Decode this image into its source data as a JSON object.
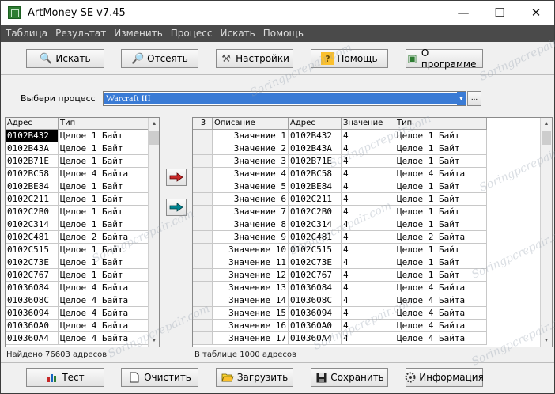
{
  "window": {
    "title": "ArtMoney SE v7.45",
    "minimize": "—",
    "maximize": "☐",
    "close": "✕"
  },
  "menu": [
    "Таблица",
    "Результат",
    "Изменить",
    "Процесс",
    "Искать",
    "Помощь"
  ],
  "toolbar": {
    "search": "Искать",
    "filter": "Отсеять",
    "settings": "Настройки",
    "help": "Помощь",
    "about": "О программе"
  },
  "process": {
    "label": "Выбери процесс",
    "value": "Warcraft III",
    "more": "..."
  },
  "left_table": {
    "columns": [
      "Адрес",
      "Тип"
    ],
    "rows": [
      [
        "0102B432",
        "Целое 1 Байт"
      ],
      [
        "0102B43A",
        "Целое 1 Байт"
      ],
      [
        "0102B71E",
        "Целое 1 Байт"
      ],
      [
        "0102BC58",
        "Целое 4 Байта"
      ],
      [
        "0102BE84",
        "Целое 1 Байт"
      ],
      [
        "0102C211",
        "Целое 1 Байт"
      ],
      [
        "0102C2B0",
        "Целое 1 Байт"
      ],
      [
        "0102C314",
        "Целое 1 Байт"
      ],
      [
        "0102C481",
        "Целое 2 Байта"
      ],
      [
        "0102C515",
        "Целое 1 Байт"
      ],
      [
        "0102C73E",
        "Целое 1 Байт"
      ],
      [
        "0102C767",
        "Целое 1 Байт"
      ],
      [
        "01036084",
        "Целое 4 Байта"
      ],
      [
        "0103608C",
        "Целое 4 Байта"
      ],
      [
        "01036094",
        "Целое 4 Байта"
      ],
      [
        "010360A0",
        "Целое 4 Байта"
      ],
      [
        "010360A4",
        "Целое 4 Байта"
      ]
    ],
    "status": "Найдено 76603 адресов"
  },
  "right_table": {
    "corner": "3",
    "columns": [
      "Описание",
      "Адрес",
      "Значение",
      "Тип"
    ],
    "rows": [
      [
        "Значение 1",
        "0102B432",
        "4",
        "Целое 1 Байт"
      ],
      [
        "Значение 2",
        "0102B43A",
        "4",
        "Целое 1 Байт"
      ],
      [
        "Значение 3",
        "0102B71E",
        "4",
        "Целое 1 Байт"
      ],
      [
        "Значение 4",
        "0102BC58",
        "4",
        "Целое 4 Байта"
      ],
      [
        "Значение 5",
        "0102BE84",
        "4",
        "Целое 1 Байт"
      ],
      [
        "Значение 6",
        "0102C211",
        "4",
        "Целое 1 Байт"
      ],
      [
        "Значение 7",
        "0102C2B0",
        "4",
        "Целое 1 Байт"
      ],
      [
        "Значение 8",
        "0102C314",
        "4",
        "Целое 1 Байт"
      ],
      [
        "Значение 9",
        "0102C481",
        "4",
        "Целое 2 Байта"
      ],
      [
        "Значение 10",
        "0102C515",
        "4",
        "Целое 1 Байт"
      ],
      [
        "Значение 11",
        "0102C73E",
        "4",
        "Целое 1 Байт"
      ],
      [
        "Значение 12",
        "0102C767",
        "4",
        "Целое 1 Байт"
      ],
      [
        "Значение 13",
        "01036084",
        "4",
        "Целое 4 Байта"
      ],
      [
        "Значение 14",
        "0103608C",
        "4",
        "Целое 4 Байта"
      ],
      [
        "Значение 15",
        "01036094",
        "4",
        "Целое 4 Байта"
      ],
      [
        "Значение 16",
        "010360A0",
        "4",
        "Целое 4 Байта"
      ],
      [
        "Значение 17",
        "010360A4",
        "4",
        "Целое 4 Байта"
      ]
    ],
    "status": "В таблице 1000 адресов"
  },
  "bottom": {
    "test": "Тест",
    "clear": "Очистить",
    "load": "Загрузить",
    "save": "Сохранить",
    "info": "Информация"
  },
  "watermark": "Soringpcrepair.com",
  "colors": {
    "menubar": "#4a4a4a",
    "selection": "#3a7bd5",
    "add_arrow": "#c62828",
    "move_arrow": "#00838f"
  }
}
